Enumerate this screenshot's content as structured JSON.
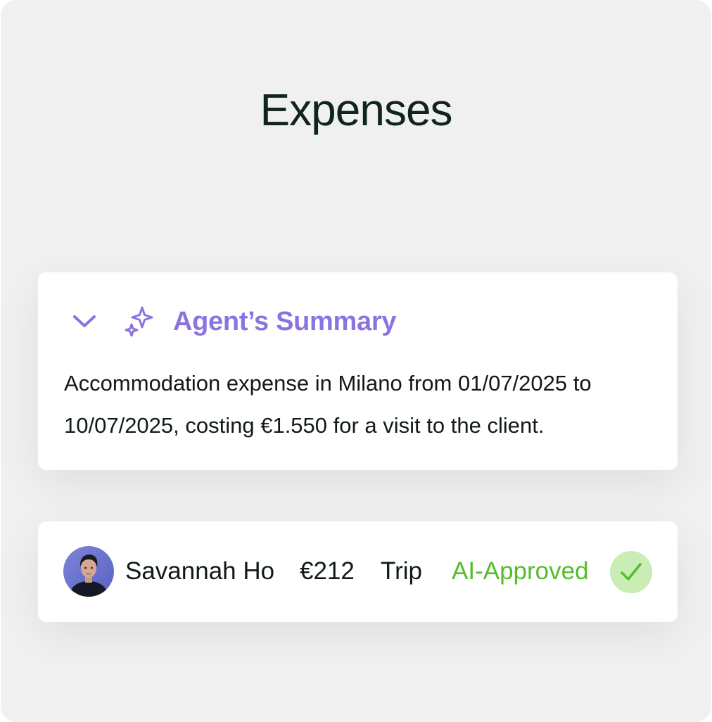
{
  "page": {
    "title": "Expenses"
  },
  "summary": {
    "title": "Agent’s Summary",
    "text": "Accommodation expense in Milano from 01/07/2025 to 10/07/2025, costing €1.550 for a visit to the client.",
    "icons": {
      "toggle": "chevron-down-icon",
      "ai": "sparkle-icon"
    }
  },
  "expense": {
    "name": "Savannah Ho",
    "amount": "€212",
    "category": "Trip",
    "status": "AI-Approved",
    "status_icon": "check-icon"
  },
  "colors": {
    "accent_purple": "#8c74e0",
    "approved_green": "#55bd2b",
    "approved_badge_bg": "#c9edb4",
    "panel_bg": "#eff0ef",
    "title_text": "#0f2420"
  }
}
